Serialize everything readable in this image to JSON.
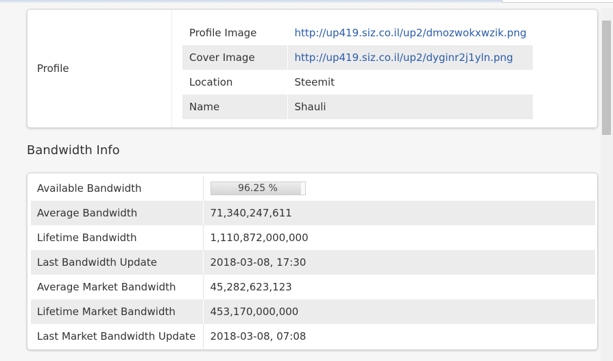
{
  "profile": {
    "label": "Profile",
    "rows": [
      {
        "key": "Profile Image",
        "value": "http://up419.siz.co.il/up2/dmozwokxwzik.png"
      },
      {
        "key": "Cover Image",
        "value": "http://up419.siz.co.il/up2/dyginr2j1yln.png"
      },
      {
        "key": "Location",
        "value": "Steemit"
      },
      {
        "key": "Name",
        "value": "Shauli"
      }
    ]
  },
  "bandwidth": {
    "title": "Bandwidth Info",
    "available": {
      "key": "Available Bandwidth",
      "value": "96.25 %",
      "fraction": 0.9625
    },
    "rows": [
      {
        "key": "Average Bandwidth",
        "value": "71,340,247,611"
      },
      {
        "key": "Lifetime Bandwidth",
        "value": "1,110,872,000,000"
      },
      {
        "key": "Last Bandwidth Update",
        "value": "2018-03-08, 17:30"
      },
      {
        "key": "Average Market Bandwidth",
        "value": "45,282,623,123"
      },
      {
        "key": "Lifetime Market Bandwidth",
        "value": "453,170,000,000"
      },
      {
        "key": "Last Market Bandwidth Update",
        "value": "2018-03-08, 07:08"
      }
    ]
  },
  "colors": {
    "link": "#2a5caa",
    "row_alt": "#ececec"
  }
}
